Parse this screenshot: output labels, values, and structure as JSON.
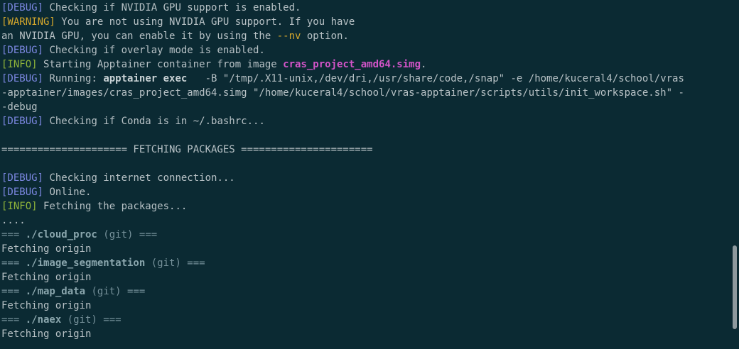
{
  "terminal": {
    "lines": [
      {
        "tag": "[DEBUG]",
        "tag_type": "debug",
        "text": " Checking if NVIDIA GPU support is enabled."
      },
      {
        "tag": "[WARNING]",
        "tag_type": "warning",
        "text": " You are not using NVIDIA GPU support. If you have"
      },
      {
        "pre": "an NVIDIA GPU, you can enable it by using the ",
        "highlight": "--nv",
        "post": " option."
      },
      {
        "tag": "[DEBUG]",
        "tag_type": "debug",
        "text": " Checking if overlay mode is enabled."
      },
      {
        "tag": "[INFO]",
        "tag_type": "info",
        "text": " Starting Apptainer container from image ",
        "image_name": "cras_project_amd64.simg",
        "post": "."
      },
      {
        "tag": "[DEBUG]",
        "tag_type": "debug",
        "text": " Running: ",
        "command": "apptainer exec",
        "post": "   -B \"/tmp/.X11-unix,/dev/dri,/usr/share/code,/snap\" -e /home/kuceral4/school/vras"
      },
      {
        "text": "-apptainer/images/cras_project_amd64.simg \"/home/kuceral4/school/vras-apptainer/scripts/utils/init_workspace.sh\" -"
      },
      {
        "text": "-debug"
      },
      {
        "tag": "[DEBUG]",
        "tag_type": "debug",
        "text": " Checking if Conda is in ~/.bashrc..."
      },
      {
        "text": ""
      },
      {
        "text": "===================== FETCHING PACKAGES ======================"
      },
      {
        "text": ""
      },
      {
        "tag": "[DEBUG]",
        "tag_type": "debug",
        "text": " Checking internet connection..."
      },
      {
        "tag": "[DEBUG]",
        "tag_type": "debug",
        "text": " Online."
      },
      {
        "tag": "[INFO]",
        "tag_type": "info",
        "text": " Fetching the packages..."
      },
      {
        "text": "...."
      },
      {
        "repo": "./cloud_proc",
        "vcs": "git"
      },
      {
        "text": "Fetching origin"
      },
      {
        "repo": "./image_segmentation",
        "vcs": "git"
      },
      {
        "text": "Fetching origin"
      },
      {
        "repo": "./map_data",
        "vcs": "git"
      },
      {
        "text": "Fetching origin"
      },
      {
        "repo": "./naex",
        "vcs": "git"
      },
      {
        "text": "Fetching origin"
      }
    ]
  },
  "colors": {
    "background": "#0b2a33",
    "debug": "#7b87e0",
    "warning": "#d4a72c",
    "info": "#8fb43a",
    "image_name": "#d254c8"
  },
  "scrollbar": {
    "position_fraction": 0.95
  }
}
